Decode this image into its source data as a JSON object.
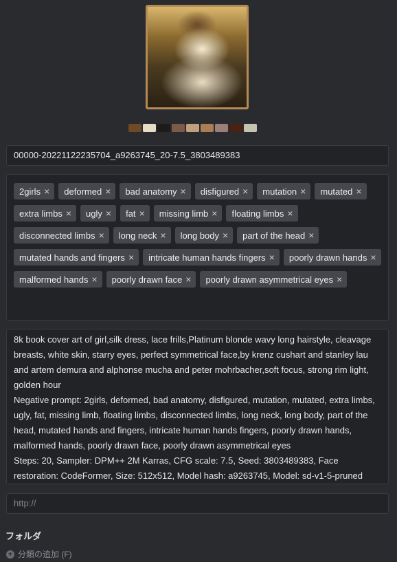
{
  "preview": {
    "alt": ""
  },
  "palette": [
    "#6e4a26",
    "#e6dcc8",
    "#1f1b18",
    "#7d5a45",
    "#c0a07e",
    "#a97d55",
    "#9a8077",
    "#4a2214",
    "#c5c4b1"
  ],
  "file_name": "00000-20221122235704_a9263745_20-7.5_3803489383",
  "tags": [
    "2girls",
    "deformed",
    "bad anatomy",
    "disfigured",
    "mutation",
    "mutated",
    "extra limbs",
    "ugly",
    "fat",
    "missing limb",
    "floating limbs",
    "disconnected limbs",
    "long neck",
    "long body",
    "part of the head",
    "mutated hands and fingers",
    "intricate human hands fingers",
    "poorly drawn hands",
    "malformed hands",
    "poorly drawn face",
    "poorly drawn asymmetrical eyes"
  ],
  "tag_remove_symbol": "×",
  "annotation": {
    "prompt": "8k book cover art of girl,silk dress, lace frills,Platinum blonde wavy long hairstyle, cleavage breasts, white skin, starry eyes, perfect symmetrical face,by krenz cushart and stanley lau and artem demura and alphonse mucha and peter mohrbacher,soft focus, strong rim light, golden hour",
    "negative": "Negative prompt: 2girls, deformed, bad anatomy, disfigured, mutation, mutated, extra limbs, ugly, fat, missing limb, floating limbs, disconnected limbs, long neck, long body, part of the head, mutated hands and fingers, intricate human hands fingers, poorly drawn hands, malformed hands, poorly drawn face, poorly drawn asymmetrical eyes",
    "params": "Steps: 20, Sampler: DPM++ 2M Karras, CFG scale: 7.5, Seed: 3803489383, Face restoration: CodeFormer, Size: 512x512, Model hash: a9263745, Model: sd-v1-5-pruned"
  },
  "url": {
    "placeholder": "http://",
    "value": ""
  },
  "folder": {
    "label": "フォルダ",
    "add_label": "分類の追加 (F)",
    "add_icon": "plus-circle-icon"
  }
}
